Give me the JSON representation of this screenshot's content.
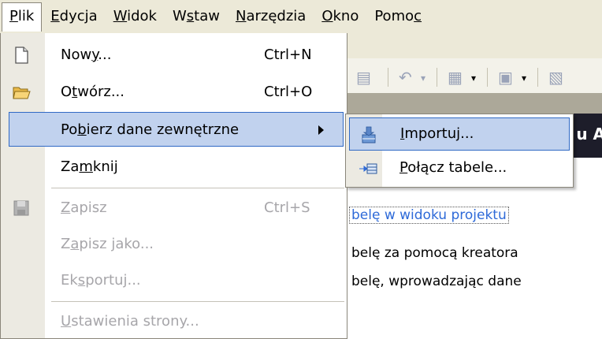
{
  "menubar": {
    "items": [
      {
        "pre": "",
        "u": "P",
        "post": "lik"
      },
      {
        "pre": "",
        "u": "E",
        "post": "dycja"
      },
      {
        "pre": "",
        "u": "W",
        "post": "idok"
      },
      {
        "pre": "W",
        "u": "s",
        "post": "taw"
      },
      {
        "pre": "",
        "u": "N",
        "post": "arzędzia"
      },
      {
        "pre": "",
        "u": "O",
        "post": "kno"
      },
      {
        "pre": "Pomo",
        "u": "c",
        "post": ""
      }
    ]
  },
  "file_menu": {
    "new": {
      "pre": "Now",
      "u": "y",
      "post": "...",
      "shortcut": "Ctrl+N"
    },
    "open": {
      "pre": "O",
      "u": "t",
      "post": "wórz...",
      "shortcut": "Ctrl+O"
    },
    "get_external": {
      "pre": "Po",
      "u": "b",
      "post": "ierz dane zewnętrzne"
    },
    "close": {
      "pre": "Za",
      "u": "m",
      "post": "knij"
    },
    "save": {
      "pre": "",
      "u": "Z",
      "post": "apisz",
      "shortcut": "Ctrl+S"
    },
    "save_as": {
      "pre": "Z",
      "u": "a",
      "post": "pisz jako..."
    },
    "export": {
      "pre": "Ek",
      "u": "s",
      "post": "portuj..."
    },
    "page_setup": {
      "pre": "",
      "u": "U",
      "post": "stawienia strony..."
    }
  },
  "submenu": {
    "import": {
      "pre": "",
      "u": "I",
      "post": "mportuj..."
    },
    "link": {
      "pre": "",
      "u": "P",
      "post": "ołącz tabele..."
    }
  },
  "background": {
    "band_text": "u A",
    "lines": [
      "belę w widoku projektu",
      "belę za pomocą kreatora",
      "belę, wprowadzając dane"
    ]
  }
}
